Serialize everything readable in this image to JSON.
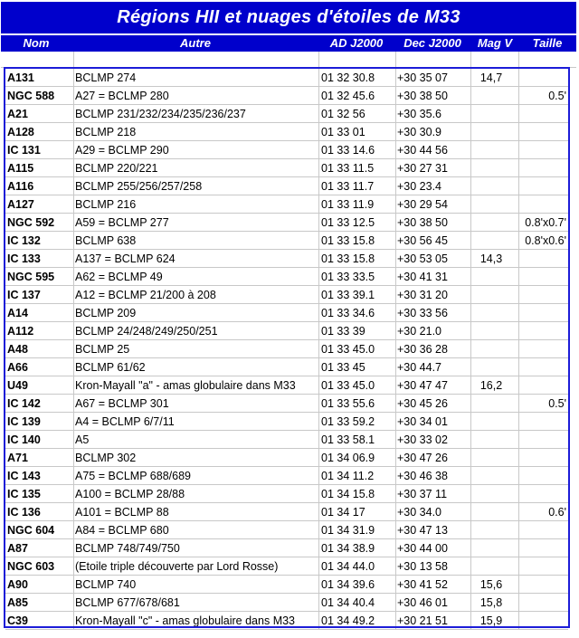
{
  "title": "Régions HII et nuages d'étoiles de M33",
  "headers": {
    "nom": "Nom",
    "autre": "Autre",
    "ad": "AD J2000",
    "dec": "Dec J2000",
    "mag": "Mag V",
    "taille": "Taille"
  },
  "rows": [
    {
      "nom": "A131",
      "autre": "BCLMP 274",
      "ad": "01 32 30.8",
      "dec": "+30 35 07",
      "mag": "14,7",
      "taille": ""
    },
    {
      "nom": "NGC 588",
      "autre": "A27 = BCLMP 280",
      "ad": "01 32 45.6",
      "dec": "+30 38 50",
      "mag": "",
      "taille": "0.5'"
    },
    {
      "nom": "A21",
      "autre": "BCLMP 231/232/234/235/236/237",
      "ad": "01 32 56",
      "dec": "+30 35.6",
      "mag": "",
      "taille": ""
    },
    {
      "nom": "A128",
      "autre": "BCLMP 218",
      "ad": "01 33 01",
      "dec": "+30 30.9",
      "mag": "",
      "taille": ""
    },
    {
      "nom": "IC 131",
      "autre": "A29 = BCLMP 290",
      "ad": "01 33 14.6",
      "dec": "+30 44 56",
      "mag": "",
      "taille": ""
    },
    {
      "nom": "A115",
      "autre": "BCLMP 220/221",
      "ad": "01 33 11.5",
      "dec": "+30 27 31",
      "mag": "",
      "taille": ""
    },
    {
      "nom": "A116",
      "autre": "BCLMP 255/256/257/258",
      "ad": "01 33 11.7",
      "dec": "+30 23.4",
      "mag": "",
      "taille": ""
    },
    {
      "nom": "A127",
      "autre": "BCLMP 216",
      "ad": "01 33 11.9",
      "dec": "+30 29 54",
      "mag": "",
      "taille": ""
    },
    {
      "nom": "NGC 592",
      "autre": "A59 = BCLMP 277",
      "ad": "01 33 12.5",
      "dec": "+30 38 50",
      "mag": "",
      "taille": "0.8'x0.7'"
    },
    {
      "nom": "IC 132",
      "autre": "BCLMP 638",
      "ad": "01 33 15.8",
      "dec": "+30 56 45",
      "mag": "",
      "taille": "0.8'x0.6'"
    },
    {
      "nom": "IC 133",
      "autre": "A137 = BCLMP 624",
      "ad": "01 33 15.8",
      "dec": "+30 53 05",
      "mag": "14,3",
      "taille": ""
    },
    {
      "nom": "NGC 595",
      "autre": "A62 = BCLMP 49",
      "ad": "01 33 33.5",
      "dec": "+30 41 31",
      "mag": "",
      "taille": ""
    },
    {
      "nom": "IC 137",
      "autre": "A12 = BCLMP 21/200 à 208",
      "ad": "01 33 39.1",
      "dec": "+30 31 20",
      "mag": "",
      "taille": ""
    },
    {
      "nom": "A14",
      "autre": "BCLMP 209",
      "ad": "01 33 34.6",
      "dec": "+30 33 56",
      "mag": "",
      "taille": ""
    },
    {
      "nom": "A112",
      "autre": "BCLMP 24/248/249/250/251",
      "ad": "01 33 39",
      "dec": "+30 21.0",
      "mag": "",
      "taille": ""
    },
    {
      "nom": "A48",
      "autre": "BCLMP 25",
      "ad": "01 33 45.0",
      "dec": "+30 36 28",
      "mag": "",
      "taille": ""
    },
    {
      "nom": "A66",
      "autre": "BCLMP 61/62",
      "ad": "01 33 45",
      "dec": "+30 44.7",
      "mag": "",
      "taille": ""
    },
    {
      "nom": "U49",
      "autre": "Kron-Mayall \"a\" - amas globulaire dans M33",
      "ad": "01 33 45.0",
      "dec": "+30 47 47",
      "mag": "16,2",
      "taille": ""
    },
    {
      "nom": "IC 142",
      "autre": "A67 = BCLMP 301",
      "ad": "01 33 55.6",
      "dec": "+30 45 26",
      "mag": "",
      "taille": "0.5'"
    },
    {
      "nom": "IC 139",
      "autre": "A4 = BCLMP 6/7/11",
      "ad": "01 33 59.2",
      "dec": "+30 34 01",
      "mag": "",
      "taille": ""
    },
    {
      "nom": "IC 140",
      "autre": "A5",
      "ad": "01 33 58.1",
      "dec": "+30 33 02",
      "mag": "",
      "taille": ""
    },
    {
      "nom": "A71",
      "autre": "BCLMP 302",
      "ad": "01 34 06.9",
      "dec": "+30 47 26",
      "mag": "",
      "taille": ""
    },
    {
      "nom": "IC 143",
      "autre": "A75 = BCLMP 688/689",
      "ad": "01 34 11.2",
      "dec": "+30 46 38",
      "mag": "",
      "taille": ""
    },
    {
      "nom": "IC 135",
      "autre": "A100 = BCLMP 28/88",
      "ad": "01 34 15.8",
      "dec": "+30 37 11",
      "mag": "",
      "taille": ""
    },
    {
      "nom": "IC 136",
      "autre": "A101 = BCLMP 88",
      "ad": "01 34 17",
      "dec": "+30 34.0",
      "mag": "",
      "taille": "0.6'"
    },
    {
      "nom": "NGC 604",
      "autre": "A84 = BCLMP 680",
      "ad": "01 34 31.9",
      "dec": "+30 47 13",
      "mag": "",
      "taille": ""
    },
    {
      "nom": "A87",
      "autre": "BCLMP 748/749/750",
      "ad": "01 34 38.9",
      "dec": "+30 44 00",
      "mag": "",
      "taille": ""
    },
    {
      "nom": "NGC 603",
      "autre": "(Etoile triple découverte par Lord Rosse)",
      "ad": "01 34 44.0",
      "dec": "+30 13 58",
      "mag": "",
      "taille": ""
    },
    {
      "nom": "A90",
      "autre": "BCLMP 740",
      "ad": "01 34 39.6",
      "dec": "+30 41 52",
      "mag": "15,6",
      "taille": ""
    },
    {
      "nom": "A85",
      "autre": "BCLMP 677/678/681",
      "ad": "01 34 40.4",
      "dec": "+30 46 01",
      "mag": "15,8",
      "taille": ""
    },
    {
      "nom": "C39",
      "autre": "Kron-Mayall \"c\" - amas globulaire dans M33",
      "ad": "01 34 49.2",
      "dec": "+30 21 51",
      "mag": "15,9",
      "taille": ""
    }
  ]
}
